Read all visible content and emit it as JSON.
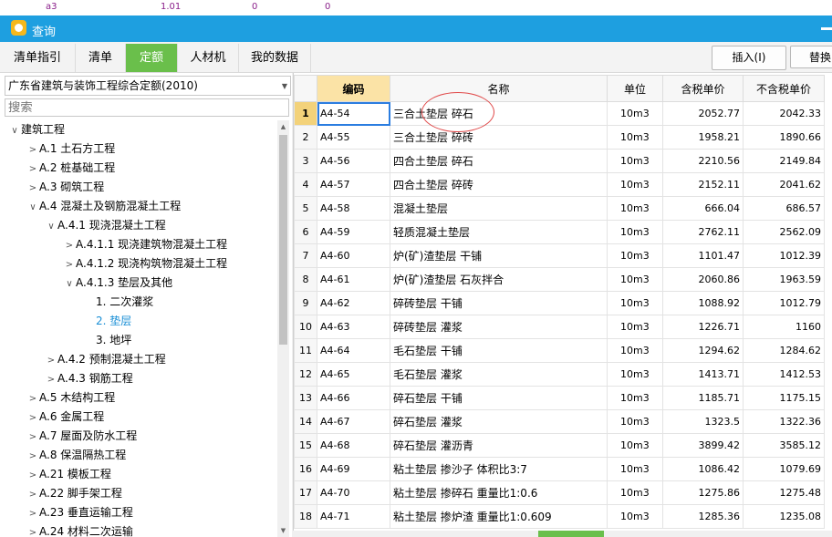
{
  "background_row": {
    "code": "a3",
    "price1": "1.01",
    "value1": "0",
    "value2": "0"
  },
  "window": {
    "title": "查询"
  },
  "tabs": [
    {
      "label": "清单指引"
    },
    {
      "label": "清单"
    },
    {
      "label": "定额"
    },
    {
      "label": "人材机"
    },
    {
      "label": "我的数据"
    }
  ],
  "toolbar": {
    "insert_label": "插入(I)",
    "replace_label": "替换"
  },
  "quota_selector": {
    "value": "广东省建筑与装饰工程综合定额(2010)"
  },
  "search": {
    "placeholder": "搜索"
  },
  "tree": [
    {
      "label": "建筑工程",
      "chevron": "down"
    },
    {
      "label": "A.1 土石方工程",
      "chevron": "right"
    },
    {
      "label": "A.2 桩基础工程",
      "chevron": "right"
    },
    {
      "label": "A.3 砌筑工程",
      "chevron": "right"
    },
    {
      "label": "A.4 混凝土及钢筋混凝土工程",
      "chevron": "down"
    },
    {
      "label": "A.4.1 现浇混凝土工程",
      "chevron": "down"
    },
    {
      "label": "A.4.1.1 现浇建筑物混凝土工程",
      "chevron": "right"
    },
    {
      "label": "A.4.1.2 现浇构筑物混凝土工程",
      "chevron": "right"
    },
    {
      "label": "A.4.1.3 垫层及其他",
      "chevron": "down"
    },
    {
      "label": "1. 二次灌浆",
      "chevron": ""
    },
    {
      "label": "2. 垫层",
      "chevron": ""
    },
    {
      "label": "3. 地坪",
      "chevron": ""
    },
    {
      "label": "A.4.2 预制混凝土工程",
      "chevron": "right"
    },
    {
      "label": "A.4.3 钢筋工程",
      "chevron": "right"
    },
    {
      "label": "A.5 木结构工程",
      "chevron": "right"
    },
    {
      "label": "A.6 金属工程",
      "chevron": "right"
    },
    {
      "label": "A.7 屋面及防水工程",
      "chevron": "right"
    },
    {
      "label": "A.8 保温隔热工程",
      "chevron": "right"
    },
    {
      "label": "A.21 模板工程",
      "chevron": "right"
    },
    {
      "label": "A.22 脚手架工程",
      "chevron": "right"
    },
    {
      "label": "A.23 垂直运输工程",
      "chevron": "right"
    },
    {
      "label": "A.24 材料二次运输",
      "chevron": "right"
    }
  ],
  "grid": {
    "headers": {
      "code": "编码",
      "name": "名称",
      "unit": "单位",
      "price_tax": "含税单价",
      "price_notax": "不含税单价"
    },
    "rows": [
      {
        "no": "1",
        "code": "A4-54",
        "name": "三合土垫层 碎石",
        "unit": "10m3",
        "price_tax": "2052.77",
        "price_notax": "2042.33"
      },
      {
        "no": "2",
        "code": "A4-55",
        "name": "三合土垫层 碎砖",
        "unit": "10m3",
        "price_tax": "1958.21",
        "price_notax": "1890.66"
      },
      {
        "no": "3",
        "code": "A4-56",
        "name": "四合土垫层 碎石",
        "unit": "10m3",
        "price_tax": "2210.56",
        "price_notax": "2149.84"
      },
      {
        "no": "4",
        "code": "A4-57",
        "name": "四合土垫层 碎砖",
        "unit": "10m3",
        "price_tax": "2152.11",
        "price_notax": "2041.62"
      },
      {
        "no": "5",
        "code": "A4-58",
        "name": "混凝土垫层",
        "unit": "10m3",
        "price_tax": "666.04",
        "price_notax": "686.57"
      },
      {
        "no": "6",
        "code": "A4-59",
        "name": "轻质混凝土垫层",
        "unit": "10m3",
        "price_tax": "2762.11",
        "price_notax": "2562.09"
      },
      {
        "no": "7",
        "code": "A4-60",
        "name": "炉(矿)渣垫层 干铺",
        "unit": "10m3",
        "price_tax": "1101.47",
        "price_notax": "1012.39"
      },
      {
        "no": "8",
        "code": "A4-61",
        "name": "炉(矿)渣垫层 石灰拌合",
        "unit": "10m3",
        "price_tax": "2060.86",
        "price_notax": "1963.59"
      },
      {
        "no": "9",
        "code": "A4-62",
        "name": "碎砖垫层 干铺",
        "unit": "10m3",
        "price_tax": "1088.92",
        "price_notax": "1012.79"
      },
      {
        "no": "10",
        "code": "A4-63",
        "name": "碎砖垫层 灌浆",
        "unit": "10m3",
        "price_tax": "1226.71",
        "price_notax": "1160"
      },
      {
        "no": "11",
        "code": "A4-64",
        "name": "毛石垫层 干铺",
        "unit": "10m3",
        "price_tax": "1294.62",
        "price_notax": "1284.62"
      },
      {
        "no": "12",
        "code": "A4-65",
        "name": "毛石垫层 灌浆",
        "unit": "10m3",
        "price_tax": "1413.71",
        "price_notax": "1412.53"
      },
      {
        "no": "13",
        "code": "A4-66",
        "name": "碎石垫层 干铺",
        "unit": "10m3",
        "price_tax": "1185.71",
        "price_notax": "1175.15"
      },
      {
        "no": "14",
        "code": "A4-67",
        "name": "碎石垫层 灌浆",
        "unit": "10m3",
        "price_tax": "1323.5",
        "price_notax": "1322.36"
      },
      {
        "no": "15",
        "code": "A4-68",
        "name": "碎石垫层 灌沥青",
        "unit": "10m3",
        "price_tax": "3899.42",
        "price_notax": "3585.12"
      },
      {
        "no": "16",
        "code": "A4-69",
        "name": "粘土垫层 掺沙子 体积比3:7",
        "unit": "10m3",
        "price_tax": "1086.42",
        "price_notax": "1079.69"
      },
      {
        "no": "17",
        "code": "A4-70",
        "name": "粘土垫层 掺碎石 重量比1:0.6",
        "unit": "10m3",
        "price_tax": "1275.86",
        "price_notax": "1275.48"
      },
      {
        "no": "18",
        "code": "A4-71",
        "name": "粘土垫层 掺炉渣 重量比1:0.609",
        "unit": "10m3",
        "price_tax": "1285.36",
        "price_notax": "1235.08"
      }
    ]
  },
  "colors": {
    "titlebar": "#1e9fe0",
    "active_tab": "#6abf4b",
    "selected_header": "#fbe3a6",
    "annotation": "#e04848"
  }
}
